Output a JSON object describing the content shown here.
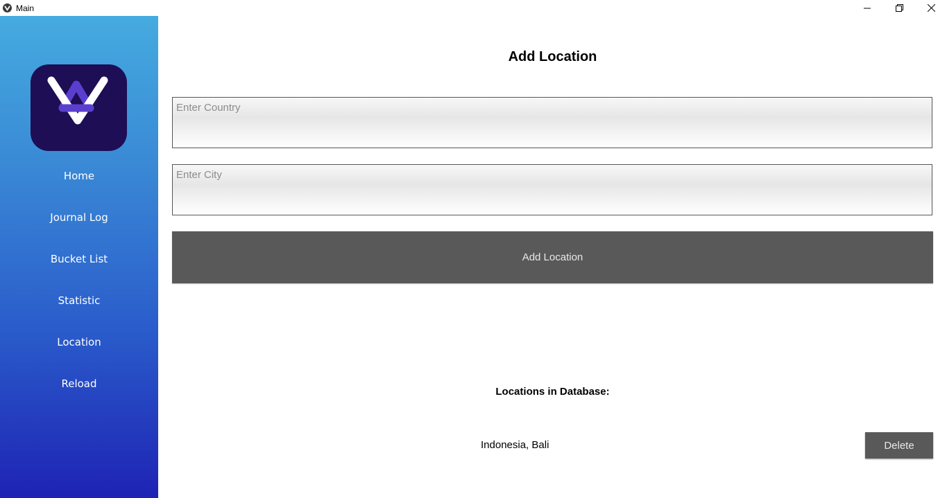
{
  "window": {
    "title": "Main",
    "controls": [
      "minimize-icon",
      "restore-icon",
      "close-icon"
    ]
  },
  "sidebar": {
    "logo_icon": "v-logo-icon",
    "items": [
      {
        "label": "Home"
      },
      {
        "label": "Journal Log"
      },
      {
        "label": "Bucket List"
      },
      {
        "label": "Statistic"
      },
      {
        "label": "Location"
      },
      {
        "label": "Reload"
      }
    ]
  },
  "main": {
    "title": "Add Location",
    "country_input": {
      "placeholder": "Enter Country",
      "value": ""
    },
    "city_input": {
      "placeholder": "Enter City",
      "value": ""
    },
    "add_button_label": "Add Location",
    "locations_heading": "Locations in Database:",
    "locations": [
      {
        "text": "Indonesia, Bali",
        "delete_label": "Delete"
      }
    ]
  },
  "colors": {
    "sidebar_top": "#45abdf",
    "sidebar_bottom": "#1e23b4",
    "logo_bg": "#1e0e55",
    "button_bg": "#595959"
  }
}
